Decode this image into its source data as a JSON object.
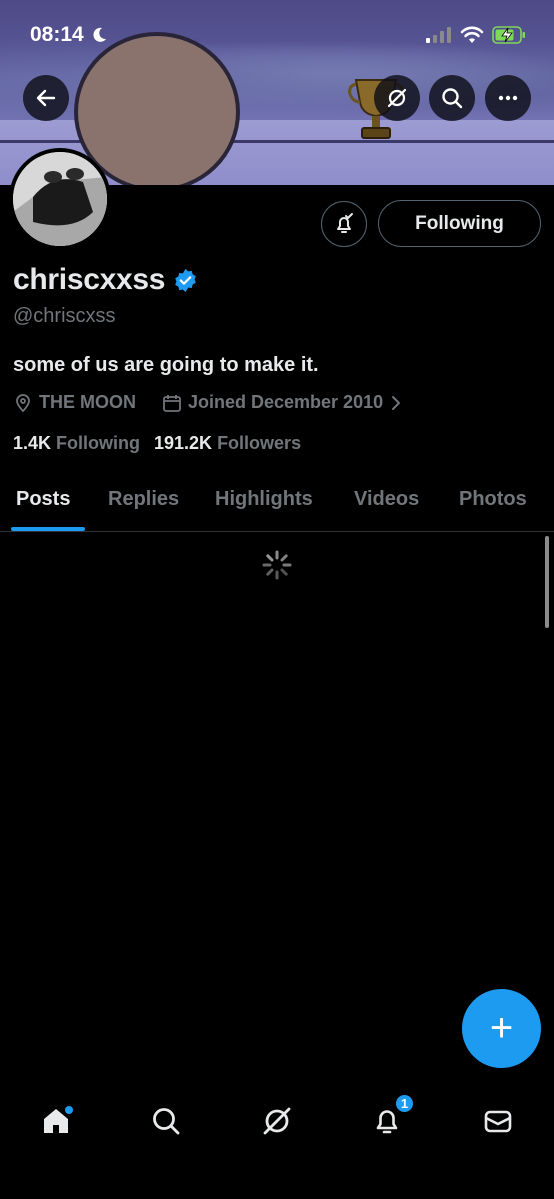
{
  "status_bar": {
    "time": "08:14",
    "icons": [
      "moon-icon",
      "cellular-signal-icon",
      "wifi-icon",
      "battery-charging-icon"
    ]
  },
  "header": {
    "back_icon": "arrow-left-icon",
    "grok_icon": "grok-icon",
    "search_icon": "search-icon",
    "more_icon": "more-horizontal-icon"
  },
  "profile": {
    "display_name": "chriscxxss",
    "verified": true,
    "handle": "@chriscxss",
    "bio": "some of us are going to make it.",
    "location": "THE MOON",
    "joined": "Joined December 2010",
    "following_count": "1.4K",
    "following_label": "Following",
    "followers_count": "191.2K",
    "followers_label": "Followers"
  },
  "actions": {
    "notify_icon": "bell-check-icon",
    "following_button": "Following"
  },
  "tabs": [
    {
      "label": "Posts",
      "active": true
    },
    {
      "label": "Replies",
      "active": false
    },
    {
      "label": "Highlights",
      "active": false
    },
    {
      "label": "Videos",
      "active": false
    },
    {
      "label": "Photos",
      "active": false
    }
  ],
  "fab": {
    "label": "+",
    "icon": "compose-plus-icon"
  },
  "bottom_nav": {
    "items": [
      "home-icon",
      "search-icon",
      "grok-icon",
      "notifications-icon",
      "messages-icon"
    ],
    "notifications_badge": "1"
  },
  "colors": {
    "accent": "#1d9bf0",
    "background": "#000000",
    "text_primary": "#e7e9ea",
    "text_secondary": "#71767b"
  }
}
